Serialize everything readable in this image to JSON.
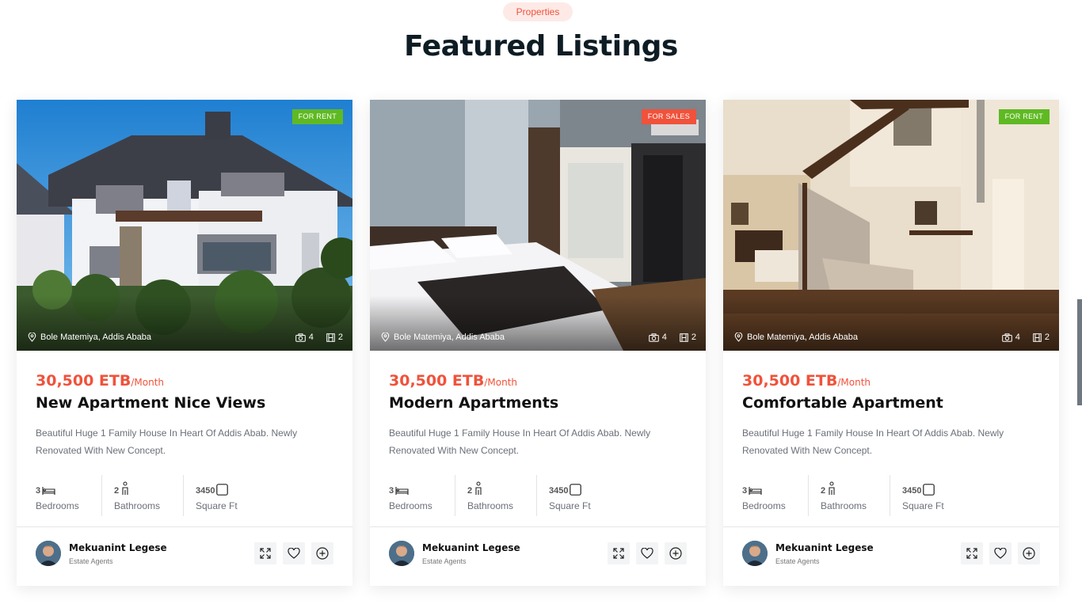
{
  "section": {
    "tag": "Properties",
    "title": "Featured Listings"
  },
  "colors": {
    "accent": "#f0523b",
    "rent_badge": "#5fb923",
    "sale_badge": "#f0523b"
  },
  "cards": [
    {
      "badge": "FOR RENT",
      "badge_type": "rent",
      "location": "Bole Matemiya, Addis Ababa",
      "photos": "4",
      "videos": "2",
      "price": "30,500 ETB",
      "period": "/Month",
      "title": "New Apartment Nice Views",
      "description": "Beautiful Huge 1 Family House In Heart Of Addis Abab. Newly Renovated With New Concept.",
      "bedrooms": "3",
      "bedrooms_label": "Bedrooms",
      "bathrooms": "2",
      "bathrooms_label": "Bathrooms",
      "area": "3450",
      "area_label": "Square Ft",
      "agent_name": "Mekuanint Legese",
      "agent_role": "Estate Agents"
    },
    {
      "badge": "FOR SALES",
      "badge_type": "sale",
      "location": "Bole Matemiya, Addis Ababa",
      "photos": "4",
      "videos": "2",
      "price": "30,500 ETB",
      "period": "/Month",
      "title": "Modern Apartments",
      "description": "Beautiful Huge 1 Family House In Heart Of Addis Abab. Newly Renovated With New Concept.",
      "bedrooms": "3",
      "bedrooms_label": "Bedrooms",
      "bathrooms": "2",
      "bathrooms_label": "Bathrooms",
      "area": "3450",
      "area_label": "Square Ft",
      "agent_name": "Mekuanint Legese",
      "agent_role": "Estate Agents"
    },
    {
      "badge": "FOR RENT",
      "badge_type": "rent",
      "location": "Bole Matemiya, Addis Ababa",
      "photos": "4",
      "videos": "2",
      "price": "30,500 ETB",
      "period": "/Month",
      "title": "Comfortable Apartment",
      "description": "Beautiful Huge 1 Family House In Heart Of Addis Abab. Newly Renovated With New Concept.",
      "bedrooms": "3",
      "bedrooms_label": "Bedrooms",
      "bathrooms": "2",
      "bathrooms_label": "Bathrooms",
      "area": "3450",
      "area_label": "Square Ft",
      "agent_name": "Mekuanint Legese",
      "agent_role": "Estate Agents"
    }
  ]
}
